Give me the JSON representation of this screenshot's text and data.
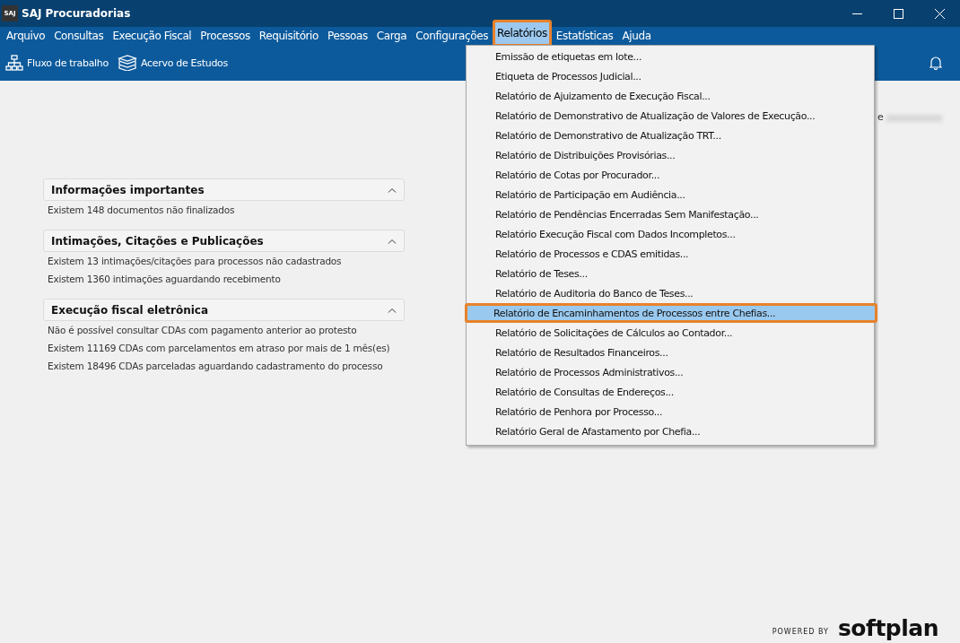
{
  "window": {
    "title": "SAJ Procuradorias",
    "logo": "SAJ"
  },
  "menu_bar": [
    {
      "label": "Arquivo",
      "selected": false
    },
    {
      "label": "Consultas",
      "selected": false
    },
    {
      "label": "Execução Fiscal",
      "selected": false
    },
    {
      "label": "Processos",
      "selected": false
    },
    {
      "label": "Requisitório",
      "selected": false
    },
    {
      "label": "Pessoas",
      "selected": false
    },
    {
      "label": "Carga",
      "selected": false
    },
    {
      "label": "Configurações",
      "selected": false
    },
    {
      "label": "Relatórios",
      "selected": true
    },
    {
      "label": "Estatísticas",
      "selected": false
    },
    {
      "label": "Ajuda",
      "selected": false
    }
  ],
  "toolbar": [
    {
      "label": "Fluxo de trabalho",
      "kind": "workflow"
    },
    {
      "label": "Acervo de Estudos",
      "kind": "books"
    }
  ],
  "dropdown": [
    {
      "label": "Emissão de etiquetas em lote...",
      "selected": false
    },
    {
      "label": "Etiqueta de Processos Judicial...",
      "selected": false
    },
    {
      "label": "Relatório de Ajuizamento de Execução Fiscal...",
      "selected": false
    },
    {
      "label": "Relatório de Demonstrativo de Atualização de Valores de Execução...",
      "selected": false
    },
    {
      "label": "Relatório de Demonstrativo de Atualização TRT...",
      "selected": false
    },
    {
      "label": "Relatório de Distribuições Provisórias...",
      "selected": false
    },
    {
      "label": "Relatório de Cotas por Procurador...",
      "selected": false
    },
    {
      "label": "Relatório de Participação em Audiência...",
      "selected": false
    },
    {
      "label": "Relatório de Pendências Encerradas Sem Manifestação...",
      "selected": false
    },
    {
      "label": "Relatório Execução Fiscal com Dados Incompletos...",
      "selected": false
    },
    {
      "label": "Relatório de Processos e CDAS emitidas...",
      "selected": false
    },
    {
      "label": "Relatório de Teses...",
      "selected": false
    },
    {
      "label": "Relatório de Auditoria do Banco de Teses...",
      "selected": false
    },
    {
      "label": "Relatório de Encaminhamentos de Processos entre Chefias...",
      "selected": true
    },
    {
      "label": "Relatório de Solicitações de Cálculos ao Contador...",
      "selected": false
    },
    {
      "label": "Relatório de Resultados Financeiros...",
      "selected": false
    },
    {
      "label": "Relatório de Processos Administrativos...",
      "selected": false
    },
    {
      "label": "Relatório de Consultas de Endereços...",
      "selected": false
    },
    {
      "label": "Relatório de Penhora por Processo...",
      "selected": false
    },
    {
      "label": "Relatório Geral de Afastamento por Chefia...",
      "selected": false
    }
  ],
  "partial_text": "e",
  "panels": [
    {
      "title": "Informações importantes",
      "expanded": true,
      "lines": [
        "Existem  148 documentos não finalizados"
      ]
    },
    {
      "title": "Intimações, Citações e Publicações",
      "expanded": true,
      "lines": [
        "Existem  13 intimações/citações para processos não cadastrados",
        "Existem  1360 intimações aguardando recebimento"
      ]
    },
    {
      "title": "Execução fiscal eletrônica",
      "expanded": true,
      "lines": [
        "Não é possível consultar CDAs com pagamento anterior ao protesto",
        "Existem  11169 CDAs com parcelamentos em atraso por mais de 1 mês(es)",
        "Existem  18496 CDAs parceladas aguardando cadastramento do processo"
      ]
    }
  ],
  "footer": {
    "powered_by": "POWERED BY",
    "brand": "softplan"
  }
}
